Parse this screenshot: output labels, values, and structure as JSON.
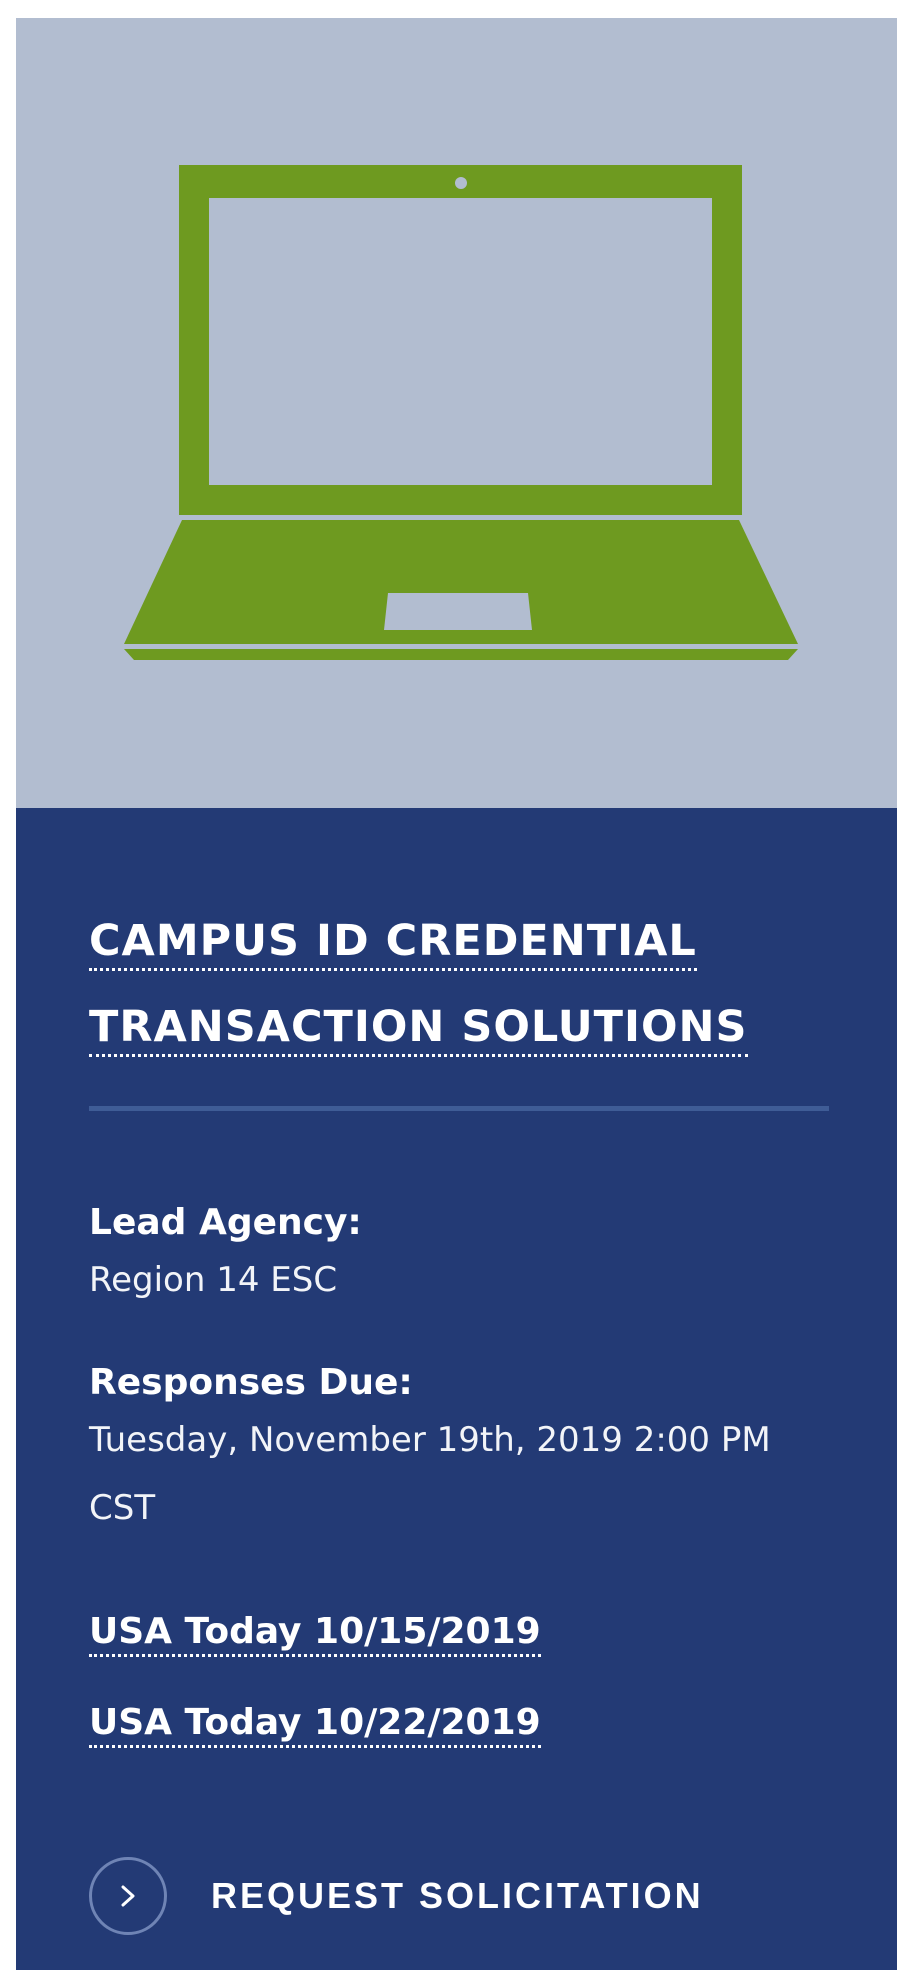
{
  "colors": {
    "hero_background": "#b2bdd0",
    "laptop_green": "#6e9a20",
    "panel_background": "#233a75",
    "divider": "#3f5c96",
    "text": "#ffffff"
  },
  "hero": {
    "icon": "laptop-icon"
  },
  "title": {
    "line1": "CAMPUS ID CREDENTIAL",
    "line2": "TRANSACTION SOLUTIONS"
  },
  "details": {
    "lead_agency_label": "Lead Agency:",
    "lead_agency_value": "Region 14 ESC",
    "responses_due_label": "Responses Due:",
    "responses_due_value": "Tuesday, November 19th, 2019 2:00 PM CST"
  },
  "links": [
    {
      "label": "USA Today 10/15/2019"
    },
    {
      "label": "USA Today 10/22/2019"
    }
  ],
  "request": {
    "label": "REQUEST SOLICITATION",
    "icon": "chevron-right-icon"
  }
}
